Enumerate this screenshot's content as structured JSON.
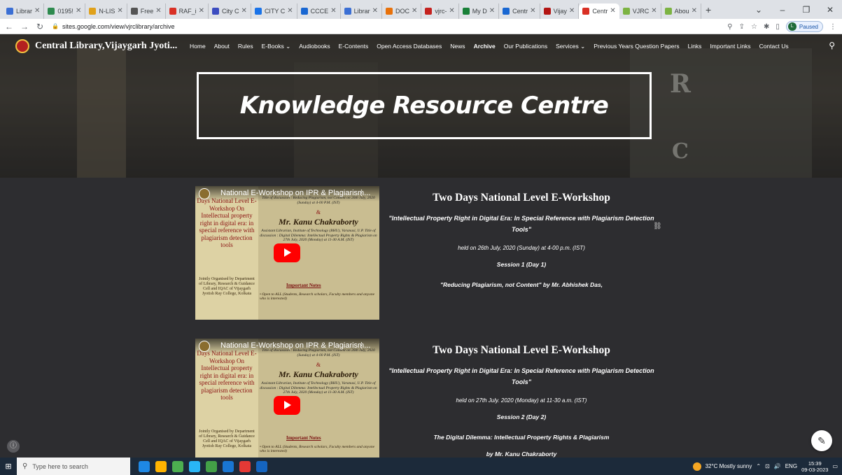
{
  "browser": {
    "tabs": [
      {
        "label": "Librar",
        "color": "#3b6fd4"
      },
      {
        "label": "0195!",
        "color": "#2d8a4e"
      },
      {
        "label": "N-LIS",
        "color": "#e0a11b"
      },
      {
        "label": "Free",
        "color": "#555555"
      },
      {
        "label": "RAF_i",
        "color": "#d93025"
      },
      {
        "label": "City C",
        "color": "#3b4cc0"
      },
      {
        "label": "CITY C",
        "color": "#1a73e8"
      },
      {
        "label": "CCCE",
        "color": "#1967d2"
      },
      {
        "label": "Librar",
        "color": "#3b6fd4"
      },
      {
        "label": "DOC",
        "color": "#e8710a"
      },
      {
        "label": "vjrc-",
        "color": "#c5221f"
      },
      {
        "label": "My D",
        "color": "#188038"
      },
      {
        "label": "Centr",
        "color": "#1967d2"
      },
      {
        "label": "Vijay",
        "color": "#b31412"
      },
      {
        "label": "Centr",
        "color": "#d93025",
        "active": true
      },
      {
        "label": "VJRC",
        "color": "#7cb342"
      },
      {
        "label": "Abou",
        "color": "#7cb342"
      }
    ],
    "new_tab": "+",
    "url": "sites.google.com/view/vjrclibrary/archive",
    "profile_status": "Paused",
    "profile_initial": "L"
  },
  "site": {
    "name": "Central Library,Vijaygarh Jyoti...",
    "menu": [
      {
        "label": "Home"
      },
      {
        "label": "About"
      },
      {
        "label": "Rules"
      },
      {
        "label": "E-Books ⌄"
      },
      {
        "label": "Audiobooks"
      },
      {
        "label": "E-Contents"
      },
      {
        "label": "Open Access Databases"
      },
      {
        "label": "News"
      },
      {
        "label": "Archive",
        "current": true
      },
      {
        "label": "Our Publications"
      },
      {
        "label": "Services ⌄"
      },
      {
        "label": "Previous Years Question Papers"
      },
      {
        "label": "Links"
      },
      {
        "label": "Important Links"
      },
      {
        "label": "Contact Us"
      }
    ],
    "hero_title": "Knowledge Resource Centre",
    "hero_letters": {
      "r": "R",
      "c": "C"
    }
  },
  "posts": [
    {
      "video_title": "National E-Workshop on IPR & Plagiarism...",
      "poster_left": "Days National Level E-Workshop On Intellectual property right in digital era: in special reference with plagiarism detection tools",
      "poster_left_small": "Jointly Organised by Department of Library, Research & Guidance Cell and IQAC of Vijaygarh Jyotish Ray College, Kolkata",
      "poster_right_top": "Title of discussion : Reducing Plagiarism, not Content on 26th July, 2020 (Sunday) at 4-00 P.M. (IST)",
      "poster_amp": "&",
      "poster_speaker": "Mr. Kanu Chakraborty",
      "poster_right_bottom": "Assistant Librarian, Institute of Technology (BHU), Varanasi, U.P. Title of discussion : Digital Dilemma: Intellectual Property Rights & Plagiarism on 27th July, 2020 (Monday) at 11-30 A.M. (IST)",
      "poster_notes": "Important Notes",
      "poster_notes_text": "• Open to ALL (Students, Research scholars, Faculty members and anyone who is interested)",
      "title": "Two Days National Level E-Workshop",
      "subtitle": "\"Intellectual Property Right in Digital Era: In Special Reference with Plagiarism Detection Tools\"",
      "held": "held on 26th July, 2020 (Sunday) at 4-00 p.m. (IST)",
      "session": "Session 1 (Day 1)",
      "body": "\"Reducing Plagiarism, not Content\" by Mr. Abhishek Das,",
      "author": ""
    },
    {
      "video_title": "National E-Workshop on IPR & Plagiarism...",
      "poster_left": "Days National Level E-Workshop On Intellectual property right in digital era: in special reference with plagiarism detection tools",
      "poster_left_small": "Jointly Organised by Department of Library, Research & Guidance Cell and IQAC of Vijaygarh Jyotish Ray College, Kolkata",
      "poster_right_top": "Title of discussion : Reducing Plagiarism, not Content on 26th July, 2020 (Sunday) at 4-00 P.M. (IST)",
      "poster_amp": "&",
      "poster_speaker": "Mr. Kanu Chakraborty",
      "poster_right_bottom": "Assistant Librarian, Institute of Technology (BHU), Varanasi, U.P. Title of discussion : Digital Dilemma: Intellectual Property Rights & Plagiarism on 27th July, 2020 (Monday) at 11-30 A.M. (IST)",
      "poster_notes": "Important Notes",
      "poster_notes_text": "• Open to ALL (Students, Research scholars, Faculty members and anyone who is interested)",
      "title": "Two Days National Level E-Workshop",
      "subtitle": "\"Intellectual Property Right in Digital Era: In Special Reference with Plagiarism Detection Tools\"",
      "held": "held on 27th July. 2020 (Monday) at 11-30 a.m. (IST)",
      "session": "Session 2 (Day 2)",
      "body": "The Digital Dilemma: Intellectual Property Rights & Plagiarism",
      "author": "by Mr. Kanu Chakraborty"
    }
  ],
  "taskbar": {
    "search_placeholder": "Type here to search",
    "weather": "32°C  Mostly sunny",
    "lang": "ENG",
    "time": "15:39",
    "date": "09-03-2023",
    "app_colors": [
      "#1e88e5",
      "#ffb300",
      "#4caf50",
      "#29b6f6",
      "#43a047",
      "#1976d2",
      "#e53935",
      "#1565c0"
    ]
  }
}
